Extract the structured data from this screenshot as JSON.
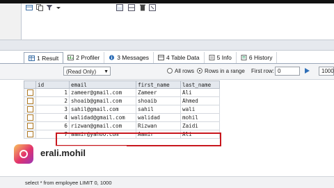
{
  "tabs": [
    {
      "label": "1 Result",
      "icon": "grid-icon"
    },
    {
      "label": "2 Profiler",
      "icon": "profiler-icon"
    },
    {
      "label": "3 Messages",
      "icon": "info-icon"
    },
    {
      "label": "4 Table Data",
      "icon": "table-icon"
    },
    {
      "label": "5 Info",
      "icon": "info-doc-icon"
    },
    {
      "label": "6 History",
      "icon": "history-icon"
    }
  ],
  "toolbar": {
    "mode_select": "(Read Only)",
    "radio_all_rows": "All rows",
    "radio_rows_range": "Rows in a range",
    "first_row_label": "First row:",
    "first_row_value": "0",
    "rows_value": "1000"
  },
  "grid": {
    "columns": [
      "id",
      "email",
      "first_name",
      "last_name"
    ],
    "rows": [
      [
        "1",
        "zameer@gmail.com",
        "Zameer",
        "Ali"
      ],
      [
        "2",
        "shoaib@gmail.com",
        "shoaib",
        "Ahmed"
      ],
      [
        "3",
        "sahil@gmail.com",
        "sahil",
        "wali"
      ],
      [
        "4",
        "walidad@gmail.com",
        "walidad",
        "mohil"
      ],
      [
        "6",
        "rizwan@gmail.com",
        "Rizwan",
        "Zaidi"
      ],
      [
        "7",
        "aamir@yahoo.com",
        "Aamir",
        "Ali"
      ]
    ]
  },
  "watermark": {
    "text": "erali.mohil"
  },
  "status": {
    "query": "select * from employee  LIMIT 0, 1000"
  },
  "colors": {
    "highlight": "#c8161d",
    "accent": "#9aa7b8"
  }
}
